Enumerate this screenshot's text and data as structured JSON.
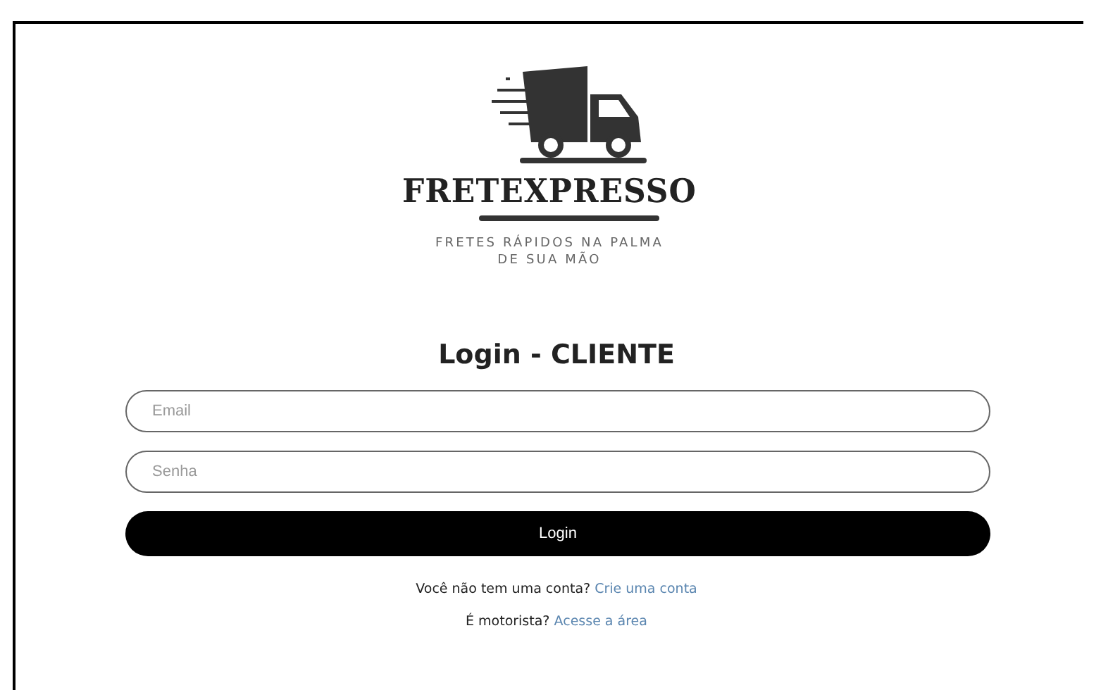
{
  "logo": {
    "brand": "FRETEXPRESSO",
    "tagline_lines": [
      "FRETES RÁPIDOS NA PALMA",
      "DE SUA MÃO"
    ]
  },
  "title": "Login - CLIENTE",
  "fields": [
    {
      "placeholder": "Email"
    },
    {
      "placeholder": "Senha"
    }
  ],
  "login_button": "Login",
  "links": [
    {
      "text": "Você não tem uma conta?",
      "link": "Crie uma conta"
    },
    {
      "text": "É motorista?",
      "link": "Acesse a área"
    }
  ]
}
